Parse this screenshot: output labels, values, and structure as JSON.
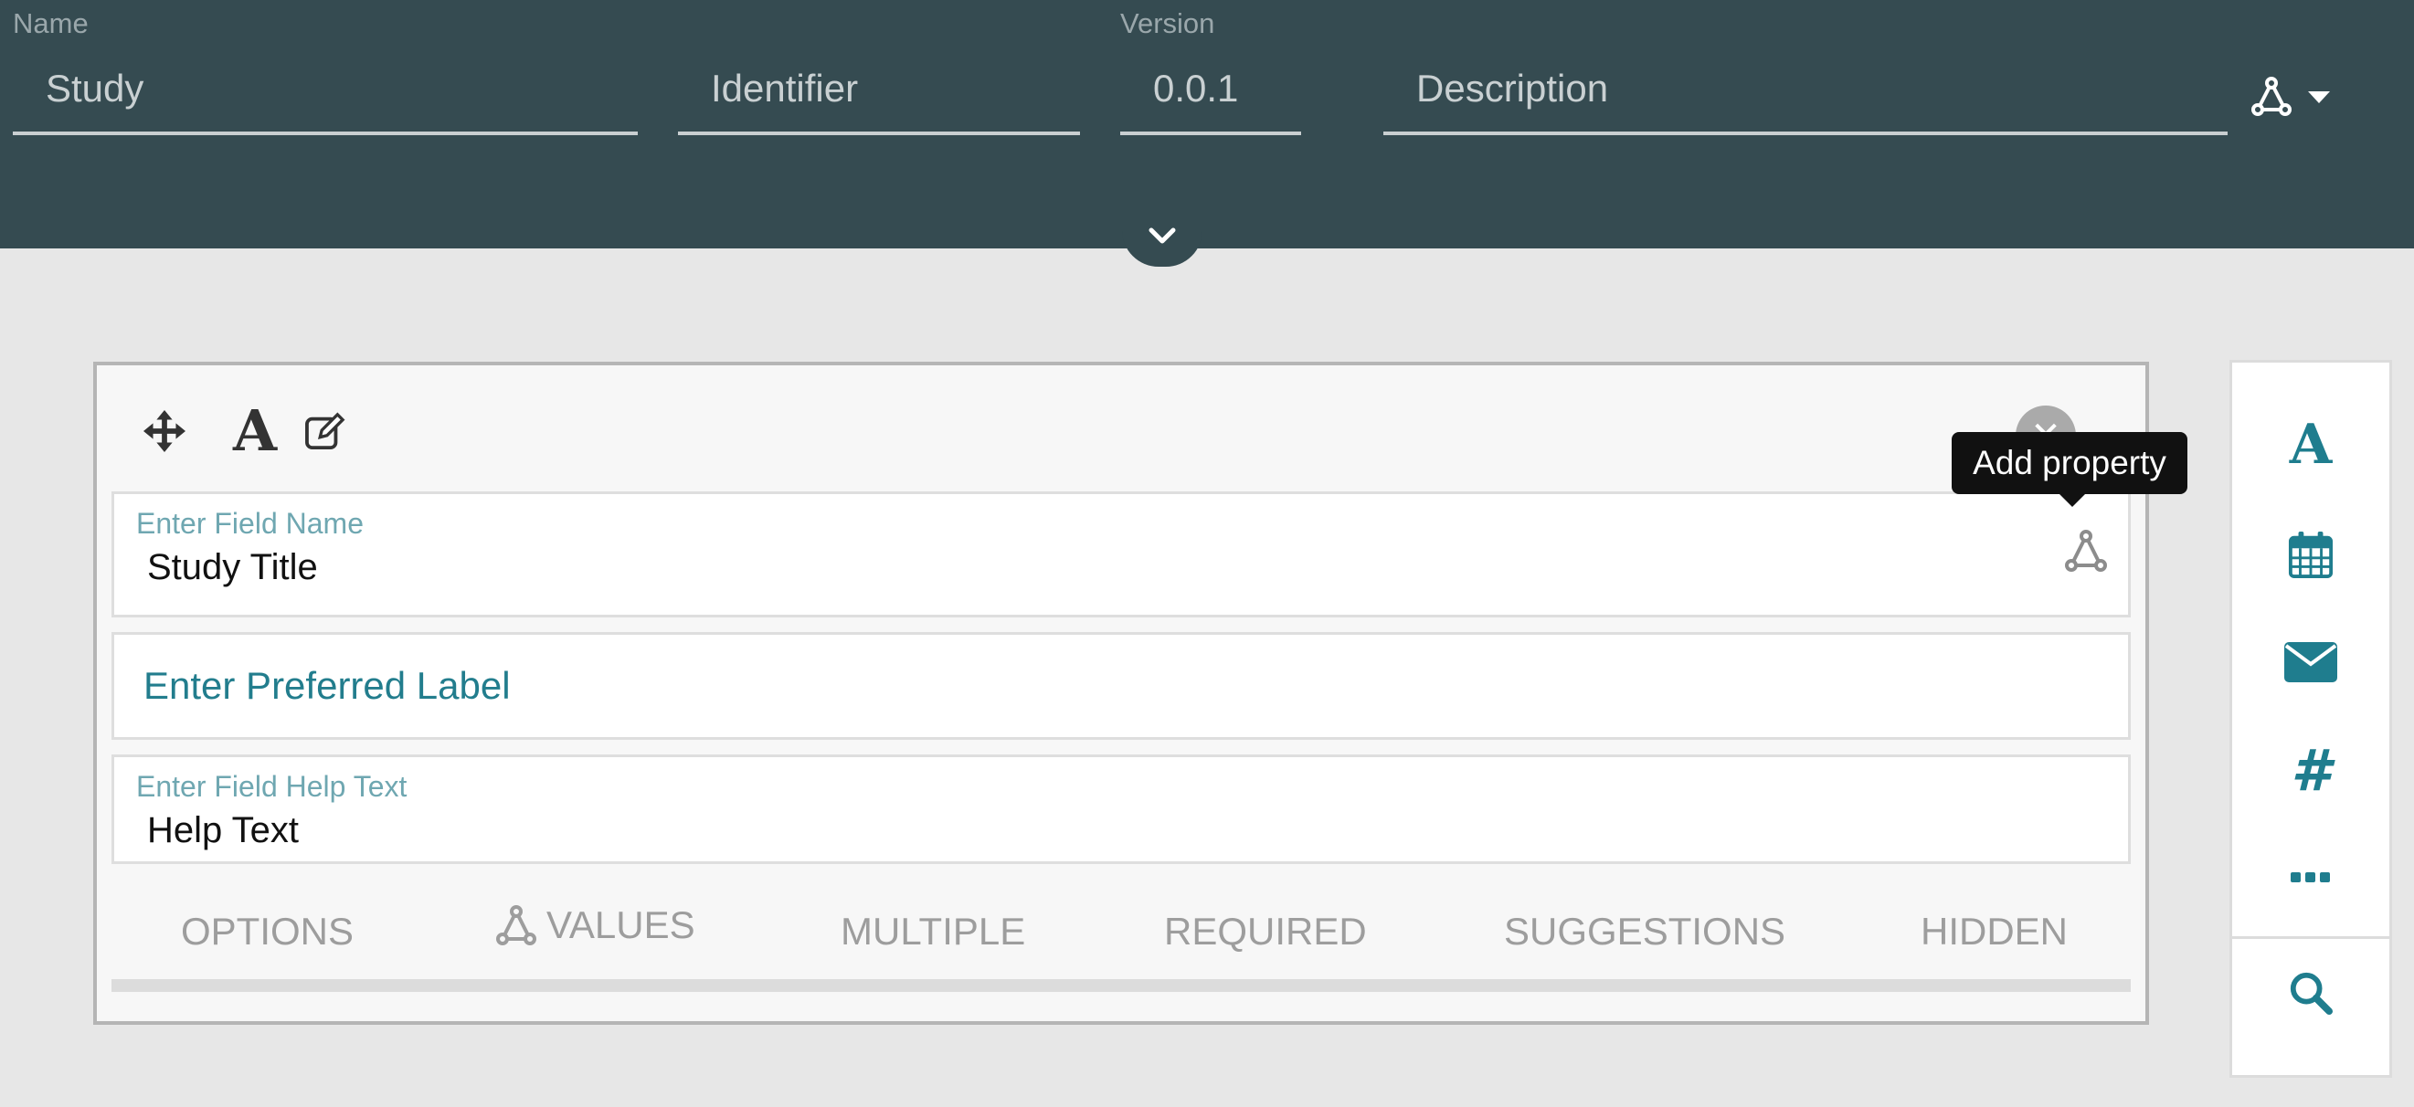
{
  "header": {
    "name_label": "Name",
    "name_value": "Study",
    "identifier_placeholder": "Identifier",
    "version_label": "Version",
    "version_value": "0.0.1",
    "description_placeholder": "Description",
    "graph_button_icon": "graph-nodes-icon",
    "collapse_icon": "chevron-down-icon",
    "background": "#354b51"
  },
  "card": {
    "toolbar_icons": [
      "move-icon",
      "text-format-icon",
      "edit-icon"
    ],
    "text_format_glyph": "A",
    "close_icon": "close-icon",
    "field_name_label": "Enter Field Name",
    "field_name_value": "Study Title",
    "preferred_label_placeholder": "Enter Preferred Label",
    "help_text_label": "Enter Field Help Text",
    "help_text_value": "Help Text",
    "options": [
      "OPTIONS",
      "VALUES",
      "MULTIPLE",
      "REQUIRED",
      "SUGGESTIONS",
      "HIDDEN"
    ]
  },
  "tooltip": {
    "text": "Add property"
  },
  "palette": {
    "items": [
      "text-field-icon",
      "calendar-icon",
      "email-icon",
      "number-icon",
      "more-icon",
      "search-icon"
    ],
    "text_glyph": "A",
    "number_glyph": "#",
    "accent": "#1f7d8e"
  }
}
